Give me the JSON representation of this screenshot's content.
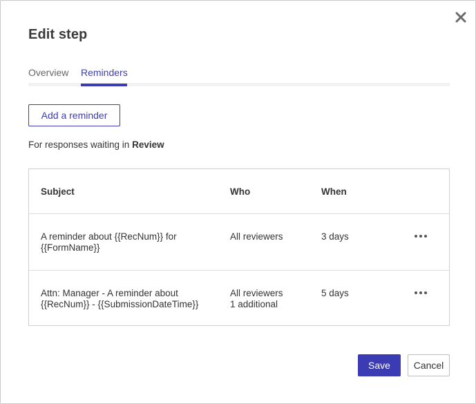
{
  "dialog": {
    "title": "Edit step",
    "close_icon": "close-icon"
  },
  "tabs": [
    {
      "label": "Overview",
      "active": false
    },
    {
      "label": "Reminders",
      "active": true
    }
  ],
  "add_button_label": "Add a reminder",
  "waiting": {
    "prefix": "For responses waiting in",
    "step": "Review"
  },
  "table": {
    "headers": {
      "subject": "Subject",
      "who": "Who",
      "when": "When"
    },
    "rows": [
      {
        "subject_line1": "A reminder about {{RecNum}} for",
        "subject_line2": "{{FormName}}",
        "who_line1": "All reviewers",
        "who_line2": "",
        "when": "3 days",
        "menu_icon": "more-horizontal-icon"
      },
      {
        "subject_line1": "Attn: Manager - A reminder about",
        "subject_line2": "{{RecNum}} - {{SubmissionDateTime}}",
        "who_line1": "All reviewers",
        "who_line2": "1 additional",
        "when": "5 days",
        "menu_icon": "more-horizontal-icon"
      }
    ]
  },
  "footer": {
    "save_label": "Save",
    "cancel_label": "Cancel"
  },
  "colors": {
    "accent": "#3b3bb3",
    "text": "#333333",
    "border": "#cfcfcf"
  }
}
